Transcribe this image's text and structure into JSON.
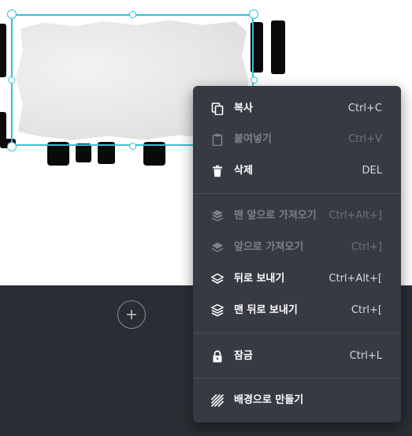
{
  "context_menu": {
    "items": [
      {
        "id": "copy",
        "label": "복사",
        "shortcut": "Ctrl+C",
        "enabled": true,
        "icon": "copy-icon"
      },
      {
        "id": "paste",
        "label": "붙여넣기",
        "shortcut": "Ctrl+V",
        "enabled": false,
        "icon": "clipboard-icon"
      },
      {
        "id": "delete",
        "label": "삭제",
        "shortcut": "DEL",
        "enabled": true,
        "icon": "trash-icon"
      },
      {
        "id": "bring-to-front",
        "label": "맨 앞으로 가져오기",
        "shortcut": "Ctrl+Alt+]",
        "enabled": false,
        "icon": "layers-up-icon"
      },
      {
        "id": "bring-forward",
        "label": "앞으로 가져오기",
        "shortcut": "Ctrl+]",
        "enabled": false,
        "icon": "layer-up-icon"
      },
      {
        "id": "send-backward",
        "label": "뒤로 보내기",
        "shortcut": "Ctrl+Alt+[",
        "enabled": true,
        "icon": "layer-down-icon"
      },
      {
        "id": "send-to-back",
        "label": "맨 뒤로 보내기",
        "shortcut": "Ctrl+[",
        "enabled": true,
        "icon": "layers-down-icon"
      },
      {
        "id": "lock",
        "label": "잠금",
        "shortcut": "Ctrl+L",
        "enabled": true,
        "icon": "lock-icon"
      },
      {
        "id": "set-background",
        "label": "배경으로 만들기",
        "shortcut": "",
        "enabled": true,
        "icon": "background-hatch-icon"
      }
    ]
  },
  "colors": {
    "selection": "#2ec4d6",
    "menu_bg": "#373a42",
    "workspace_bg": "#2a2d33",
    "canvas_bg": "#ffffff"
  }
}
